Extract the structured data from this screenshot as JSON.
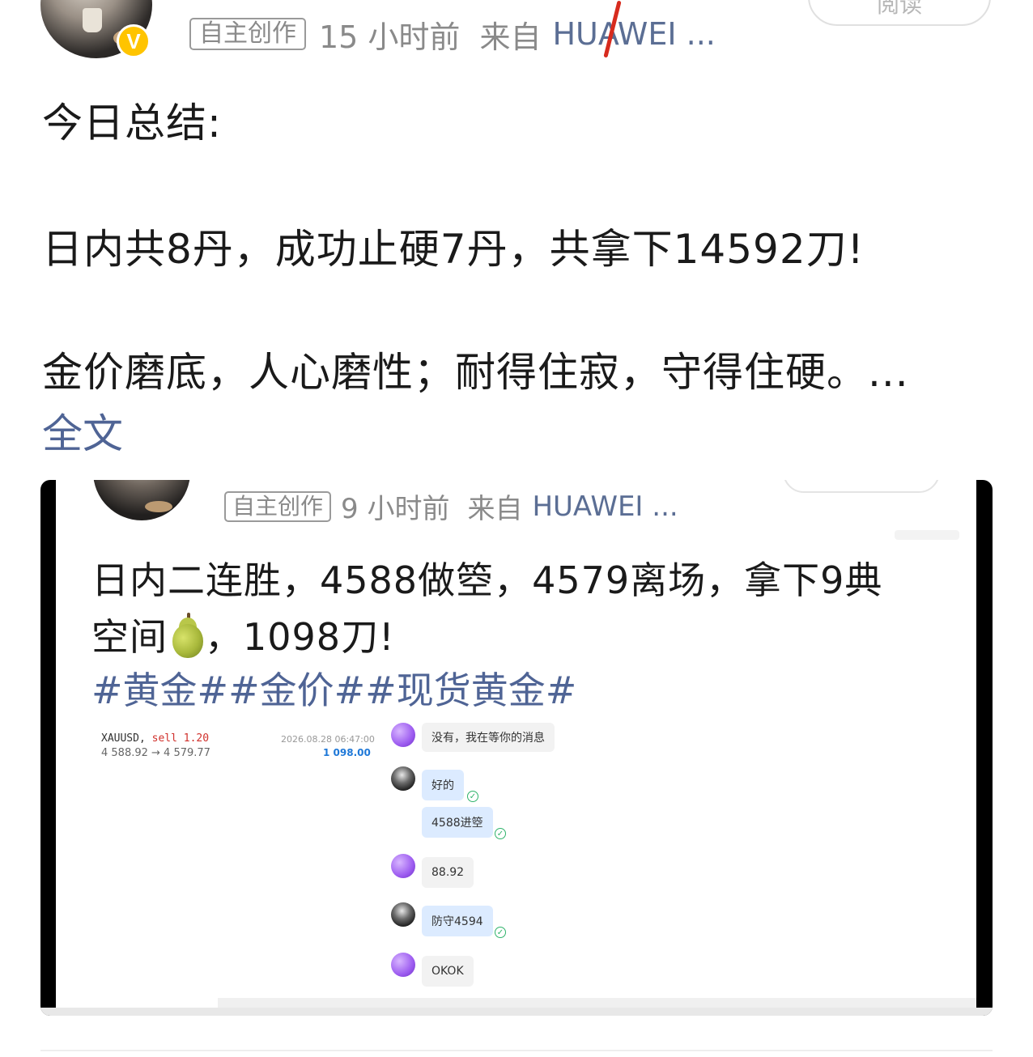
{
  "header": {
    "tag": "自主创作",
    "time": "15 小时前",
    "source_prefix": "来自",
    "source": "HUAWEI ...",
    "read_button": "阅读",
    "verified_badge": "V"
  },
  "post": {
    "line1": "今日总结:",
    "line2": "日内共8丹，成功止硬7丹，共拿下14592刀!",
    "line3": "金价磨底，人心磨性；耐得住寂，守得住硬。...",
    "full_text_link": "全文"
  },
  "embedded": {
    "tag": "自主创作",
    "time": "9 小时前",
    "source_prefix": "来自",
    "source": "HUAWEI ...",
    "line1": "日内二连胜，4588做箜，4579离场，拿下9典",
    "line2_before": "空间",
    "line2_after": "，1098刀!",
    "hashtags": "#黄金##金价##现货黄金#",
    "trade": {
      "symbol": "XAUUSD,",
      "side": "sell 1.20",
      "range": "4 588.92 → 4 579.77",
      "date": "2026.08.28 06:47:00",
      "profit": "1 098.00"
    },
    "chat": [
      {
        "author": "purple",
        "text": "没有，我在等你的消息"
      },
      {
        "author": "dark",
        "text": "好的"
      },
      {
        "author": "dark",
        "text": "4588进箜"
      },
      {
        "author": "purple",
        "text": "88.92"
      },
      {
        "author": "dark",
        "text": "防守4594"
      },
      {
        "author": "purple",
        "text": "OKOK"
      }
    ]
  },
  "colors": {
    "link": "#4f6495",
    "source": "#5b6e94",
    "verified": "#ffc400",
    "profit": "#1e78d8"
  }
}
